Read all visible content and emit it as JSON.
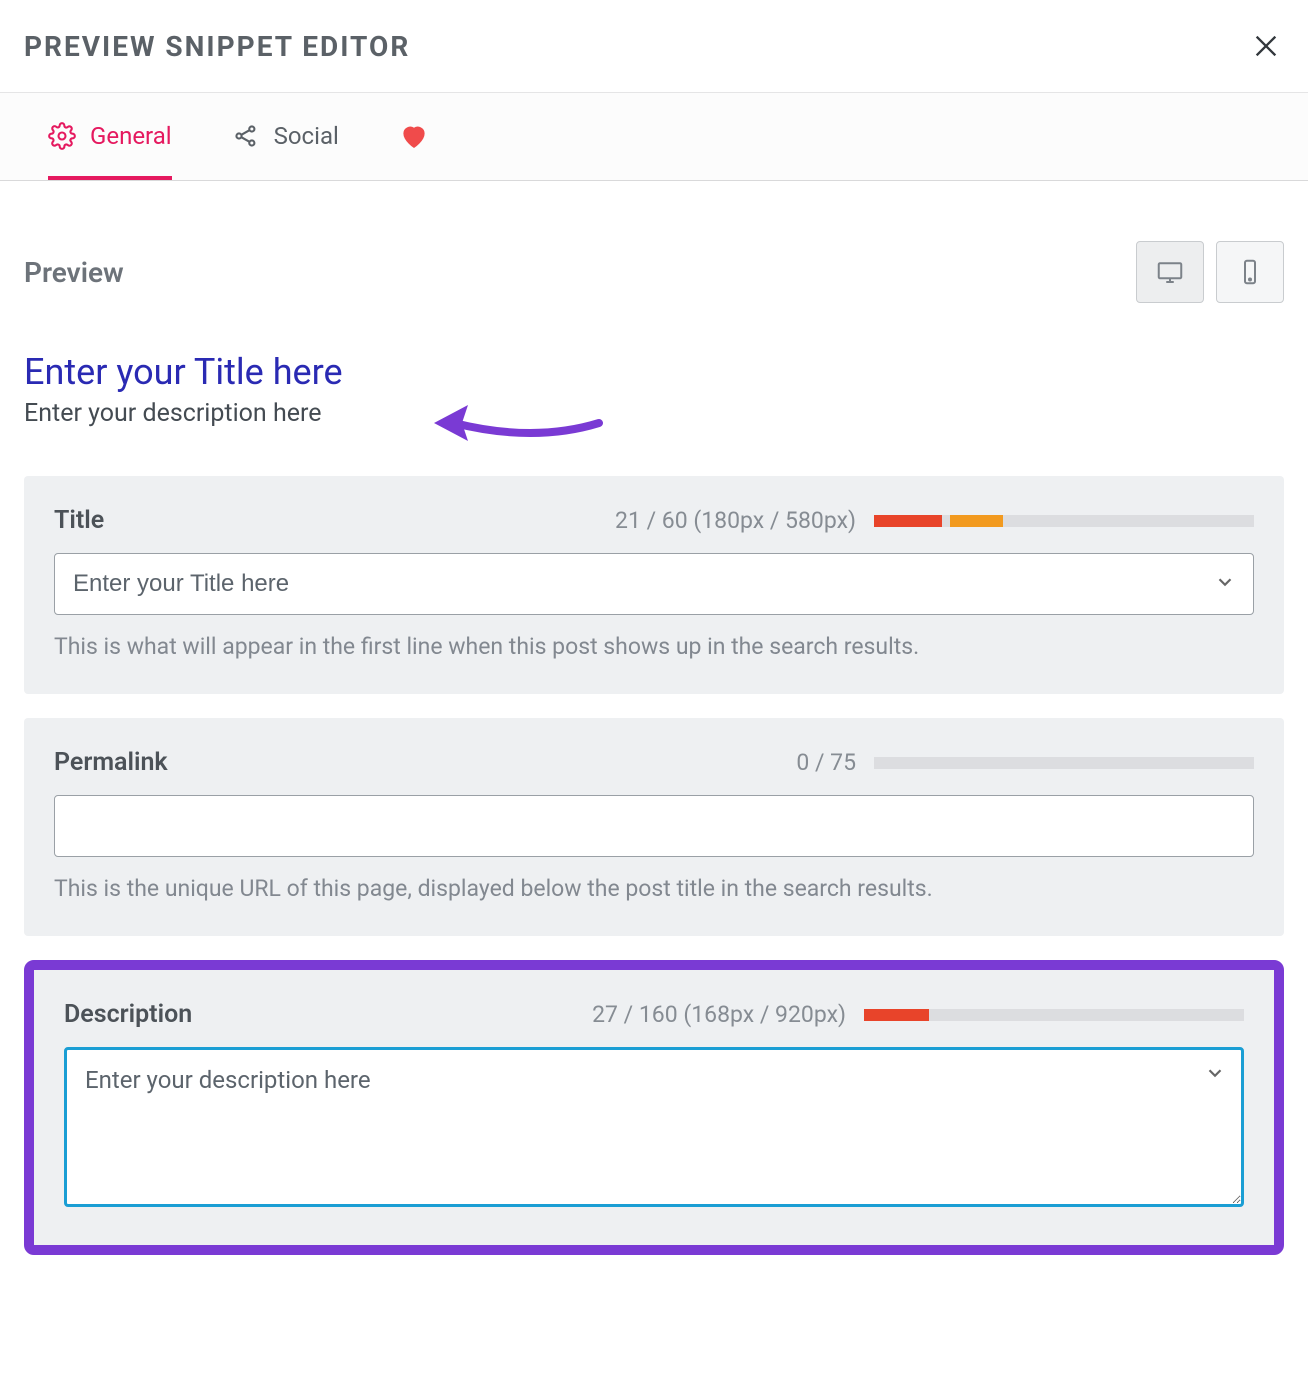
{
  "header": {
    "title": "PREVIEW SNIPPET EDITOR"
  },
  "tabs": {
    "general": "General",
    "social": "Social"
  },
  "preview": {
    "section_label": "Preview",
    "snippet_title": "Enter your Title here",
    "snippet_description": "Enter your description here"
  },
  "fields": {
    "title": {
      "label": "Title",
      "counter": "21 / 60 (180px / 580px)",
      "value": "Enter your Title here",
      "helper": "This is what will appear in the first line when this post shows up in the search results.",
      "meter": {
        "segments": [
          {
            "start": 0,
            "end": 18,
            "color": "#e8442a"
          },
          {
            "start": 20,
            "end": 34,
            "color": "#f29a1f"
          }
        ]
      }
    },
    "permalink": {
      "label": "Permalink",
      "counter": "0 / 75",
      "value": "",
      "helper": "This is the unique URL of this page, displayed below the post title in the search results.",
      "meter": {
        "segments": []
      }
    },
    "description": {
      "label": "Description",
      "counter": "27 / 160 (168px / 920px)",
      "value": "Enter your description here",
      "meter": {
        "segments": [
          {
            "start": 0,
            "end": 17,
            "color": "#e8442a"
          }
        ]
      }
    }
  },
  "colors": {
    "accent": "#e5195f",
    "highlight": "#7a3ad4",
    "link": "#2a2ab3"
  }
}
